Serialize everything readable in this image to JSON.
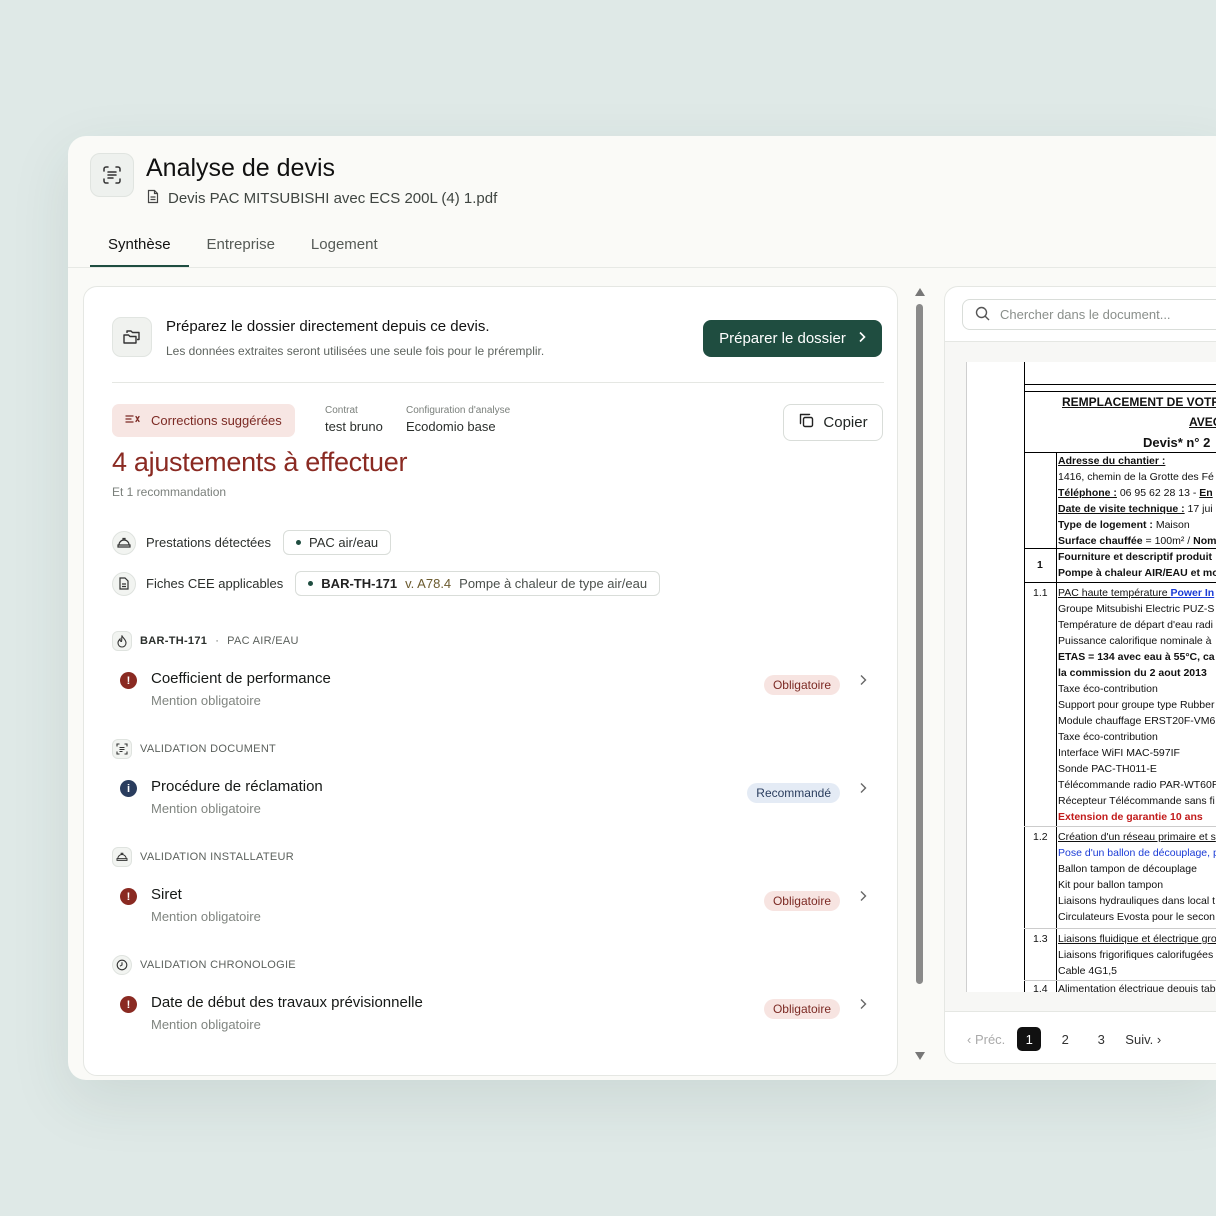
{
  "header": {
    "title": "Analyse de devis",
    "file_name": "Devis PAC MITSUBISHI avec ECS 200L (4) 1.pdf"
  },
  "tabs": [
    {
      "label": "Synthèse",
      "active": true
    },
    {
      "label": "Entreprise",
      "active": false
    },
    {
      "label": "Logement",
      "active": false
    }
  ],
  "prepare": {
    "title": "Préparez le dossier directement depuis ce devis.",
    "subtitle": "Les données extraites seront utilisées une seule fois pour le préremplir.",
    "button_label": "Préparer le dossier"
  },
  "summary": {
    "corrections_badge": "Corrections suggérées",
    "contract_label": "Contrat",
    "contract_value": "test bruno",
    "config_label": "Configuration d'analyse",
    "config_value": "Ecodomio base",
    "copy_label": "Copier",
    "headline": "4 ajustements à effectuer",
    "recommendation": "Et 1 recommandation"
  },
  "detected": {
    "prestations_label": "Prestations détectées",
    "prestation_chip": "PAC air/eau",
    "fiches_label": "Fiches CEE applicables",
    "fiche_code": "BAR-TH-171",
    "fiche_version": "v. A78.4",
    "fiche_desc": "Pompe à chaleur de type air/eau"
  },
  "sections": [
    {
      "header_code": "BAR-TH-171",
      "header_sep": "·",
      "header_tag": "PAC AIR/EAU",
      "icon": "flame-icon",
      "item": {
        "title": "Coefficient de performance",
        "sub": "Mention obligatoire",
        "badge": "Obligatoire",
        "severity": "error"
      }
    },
    {
      "header_tag": "VALIDATION DOCUMENT",
      "icon": "document-scan-icon",
      "item": {
        "title": "Procédure de réclamation",
        "sub": "Mention obligatoire",
        "badge": "Recommandé",
        "severity": "info"
      }
    },
    {
      "header_tag": "VALIDATION INSTALLATEUR",
      "icon": "helmet-icon",
      "item": {
        "title": "Siret",
        "sub": "Mention obligatoire",
        "badge": "Obligatoire",
        "severity": "error"
      }
    },
    {
      "header_tag": "VALIDATION CHRONOLOGIE",
      "icon": "clock-icon",
      "item": {
        "title": "Date de début des travaux prévisionnelle",
        "sub": "Mention obligatoire",
        "badge": "Obligatoire",
        "severity": "error"
      }
    }
  ],
  "document": {
    "search_placeholder": "Chercher dans le document...",
    "lines": {
      "l1": "REMPLACEMENT DE VOTR",
      "l2": "AVEC",
      "l3": "Devis* n° 2",
      "a1": "Adresse du chantier :",
      "a2": "1416, chemin de la Grotte des Fé",
      "a3a": "Téléphone :",
      "a3b": " 06 95 62 28 13 - ",
      "a3c": "En",
      "a4a": "Date de visite technique :",
      "a4b": " 17 jui",
      "a5a": "Type de logement :",
      "a5b": " Maison",
      "a6a": "Surface chauffée",
      "a6b": " = 100m² / ",
      "a6c": "Nom",
      "n1": "1",
      "f1": "Fourniture et descriptif produit",
      "f2": "Pompe à chaleur AIR/EAU et mo",
      "n11": "1.1",
      "p1a": "PAC haute température ",
      "p1b": "Power In",
      "p2": "Groupe Mitsubishi Electric PUZ-S",
      "p3": "Température de départ d'eau radi",
      "p4": "Puissance calorifique nominale à",
      "p5": "ETAS = 134 avec eau à 55°C, ca",
      "p6": "la commission du 2 aout 2013",
      "p7": "Taxe éco-contribution",
      "p8": "Support pour groupe type Rubber",
      "p9": "Module chauffage  ERST20F-VM6",
      "p10": "Taxe éco-contribution",
      "p11": "Interface WiFI MAC-597IF",
      "p12": "Sonde PAC-TH011-E",
      "p13": "Télécommande radio PAR-WT60R",
      "p14": "Récepteur Télécommande sans fi",
      "p15": "Extension de garantie 10 ans",
      "n12": "1.2",
      "q1": "Création d'un réseau primaire et s",
      "q2": "Pose d'un ballon de découplage, p",
      "q3": "Ballon tampon de découplage",
      "q4": "Kit pour ballon tampon",
      "q5": "Liaisons hydrauliques dans local t",
      "q6": "Circulateurs Evosta pour le secon",
      "n13": "1.3",
      "r1": "Liaisons fluidique et électrique gro",
      "r2": "Liaisons frigorifiques calorifugées",
      "r3": "Cable 4G1,5",
      "n14": "1.4",
      "r4": "Alimentation électrique depuis tab"
    },
    "pager": {
      "prev": "‹ Préc.",
      "pages": [
        "1",
        "2",
        "3"
      ],
      "current": "1",
      "next": "Suiv. ›"
    }
  },
  "colors": {
    "accent": "#1f4d40",
    "danger": "#8a2a22",
    "info": "#2a3d5e",
    "background": "#dfe9e7"
  }
}
